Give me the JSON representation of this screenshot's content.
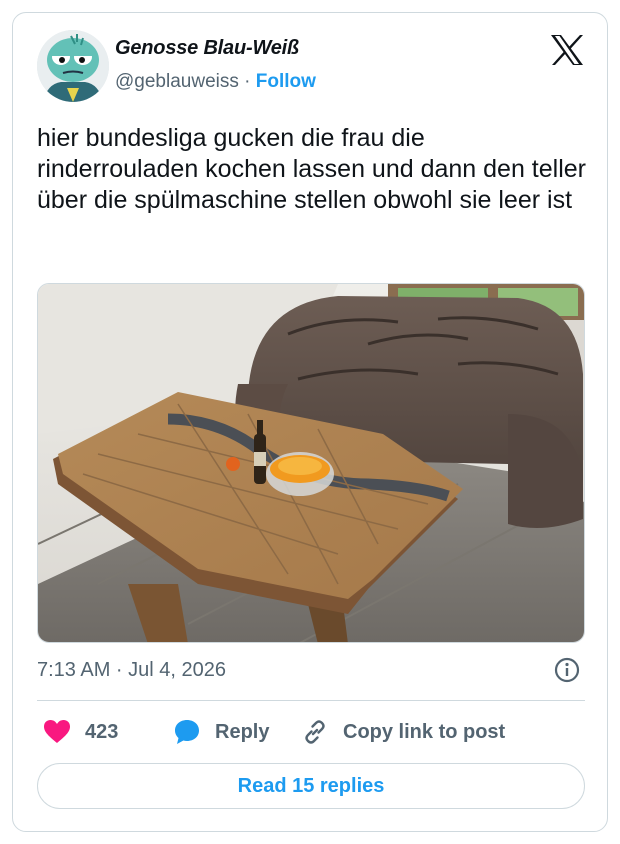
{
  "author": {
    "display_name": "Genosse Blau-Weiß",
    "handle": "@geblauweiss",
    "separator": "·",
    "follow_label": "Follow"
  },
  "tweet": {
    "text": "hier bundesliga gucken die frau die rinderrouladen kochen lassen und dann den teller über die spülmaschine stellen obwohl sie leer ist",
    "timestamp": "7:13 AM · Jul 4, 2026"
  },
  "actions": {
    "like_count": "423",
    "reply_label": "Reply",
    "copy_link_label": "Copy link to post"
  },
  "footer": {
    "read_replies_label": "Read 15 replies"
  },
  "colors": {
    "accent": "#1d9bf0",
    "like": "#f91880",
    "text": "#0f1419",
    "muted": "#536471",
    "border": "#cfd9de"
  },
  "icons": {
    "logo": "x-logo-icon",
    "info": "info-icon",
    "like": "heart-icon",
    "reply": "speech-bubble-icon",
    "copy": "link-icon"
  }
}
